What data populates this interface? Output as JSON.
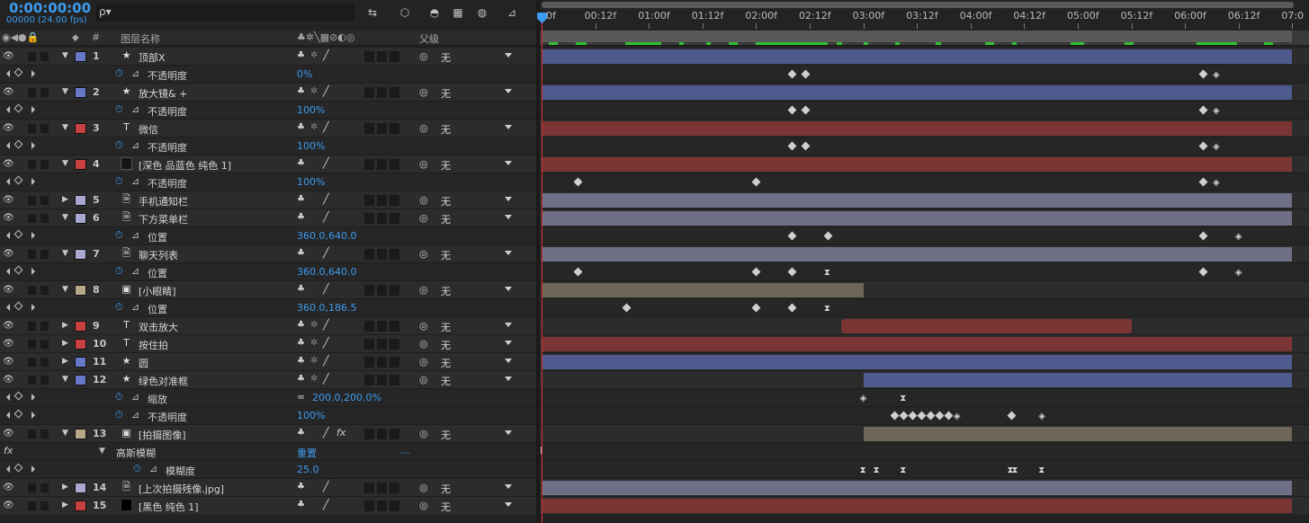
{
  "header": {
    "timecode": "0:00:00:00",
    "frames": "00000 (24.00 fps)",
    "search_icon": "ρ▾"
  },
  "columns": {
    "name": "图层名称",
    "number": "#",
    "parent": "父级"
  },
  "ruler": {
    "ticks": [
      "0f",
      "00:12f",
      "01:00f",
      "01:12f",
      "02:00f",
      "02:12f",
      "03:00f",
      "03:12f",
      "04:00f",
      "04:12f",
      "05:00f",
      "05:12f",
      "06:00f",
      "06:12f",
      "07:0"
    ]
  },
  "rows": [
    {
      "kind": "layer",
      "num": "1",
      "type": "star",
      "name": "顶部X",
      "color": "#6878c8",
      "twirl": "open",
      "switches": "shape",
      "parent": "无",
      "bar": {
        "start": 0,
        "end": 7.0,
        "color": "#4f5a8f"
      }
    },
    {
      "kind": "prop",
      "name": "不透明度",
      "value": "0%",
      "kf": [
        {
          "t": 2.333,
          "s": "d"
        },
        {
          "t": 2.458,
          "s": "d"
        },
        {
          "t": 6.167,
          "s": "d"
        },
        {
          "t": 6.292,
          "s": "h"
        }
      ]
    },
    {
      "kind": "layer",
      "num": "2",
      "type": "star",
      "name": "放大镜& +",
      "color": "#6878c8",
      "twirl": "open",
      "switches": "shape",
      "parent": "无",
      "bar": {
        "start": 0,
        "end": 7.0,
        "color": "#4f5a8f"
      }
    },
    {
      "kind": "prop",
      "name": "不透明度",
      "value": "100%",
      "kf": [
        {
          "t": 2.333,
          "s": "d"
        },
        {
          "t": 2.458,
          "s": "d"
        },
        {
          "t": 6.167,
          "s": "d"
        },
        {
          "t": 6.292,
          "s": "h"
        }
      ]
    },
    {
      "kind": "layer",
      "num": "3",
      "type": "text",
      "name": "微信",
      "color": "#c84040",
      "twirl": "open",
      "switches": "shape",
      "parent": "无",
      "bar": {
        "start": 0,
        "end": 7.0,
        "color": "#7c3535"
      }
    },
    {
      "kind": "prop",
      "name": "不透明度",
      "value": "100%",
      "kf": [
        {
          "t": 2.333,
          "s": "d"
        },
        {
          "t": 2.458,
          "s": "d"
        },
        {
          "t": 6.167,
          "s": "d"
        },
        {
          "t": 6.292,
          "s": "h"
        }
      ]
    },
    {
      "kind": "layer",
      "num": "4",
      "type": "solid",
      "name": "[深色 品蓝色 纯色 1]",
      "color": "#c84040",
      "twirl": "open",
      "switches": "plain",
      "parent": "无",
      "bar": {
        "start": 0,
        "end": 7.0,
        "color": "#7c3535"
      }
    },
    {
      "kind": "prop",
      "name": "不透明度",
      "value": "100%",
      "kf": [
        {
          "t": 0.333,
          "s": "d"
        },
        {
          "t": 2.0,
          "s": "d"
        },
        {
          "t": 6.167,
          "s": "d"
        },
        {
          "t": 6.292,
          "s": "h"
        }
      ]
    },
    {
      "kind": "layer",
      "num": "5",
      "type": "file",
      "name": "手机通知栏",
      "color": "#a8a8d0",
      "twirl": "closed",
      "switches": "plain",
      "parent": "无",
      "bar": {
        "start": 0,
        "end": 7.0,
        "color": "#6f6f86"
      }
    },
    {
      "kind": "layer",
      "num": "6",
      "type": "file",
      "name": "下方菜单栏",
      "color": "#a8a8d0",
      "twirl": "open",
      "switches": "plain",
      "parent": "无",
      "bar": {
        "start": 0,
        "end": 7.0,
        "color": "#6f6f86"
      }
    },
    {
      "kind": "prop",
      "name": "位置",
      "value": "360.0,640.0",
      "kf": [
        {
          "t": 2.333,
          "s": "d"
        },
        {
          "t": 2.667,
          "s": "d"
        },
        {
          "t": 6.167,
          "s": "d"
        },
        {
          "t": 6.5,
          "s": "h"
        }
      ]
    },
    {
      "kind": "layer",
      "num": "7",
      "type": "file",
      "name": "聊天列表",
      "color": "#a8a8d0",
      "twirl": "open",
      "switches": "plain",
      "parent": "无",
      "bar": {
        "start": 0,
        "end": 7.0,
        "color": "#6f6f86"
      }
    },
    {
      "kind": "prop",
      "name": "位置",
      "value": "360.0,640.0",
      "kf": [
        {
          "t": 0.333,
          "s": "d"
        },
        {
          "t": 2.0,
          "s": "d"
        },
        {
          "t": 2.333,
          "s": "d"
        },
        {
          "t": 2.667,
          "s": "x"
        },
        {
          "t": 6.167,
          "s": "d"
        },
        {
          "t": 6.5,
          "s": "h"
        }
      ]
    },
    {
      "kind": "layer",
      "num": "8",
      "type": "comp",
      "name": "[小眼睛]",
      "color": "#b8a888",
      "twirl": "open",
      "switches": "plain",
      "parent": "无",
      "bar": {
        "start": 0,
        "end": 3.0,
        "color": "#6e6656"
      }
    },
    {
      "kind": "prop",
      "name": "位置",
      "value": "360.0,186.5",
      "kf": [
        {
          "t": 0.792,
          "s": "d"
        },
        {
          "t": 2.0,
          "s": "d"
        },
        {
          "t": 2.333,
          "s": "d"
        },
        {
          "t": 2.667,
          "s": "x"
        }
      ]
    },
    {
      "kind": "layer",
      "num": "9",
      "type": "text",
      "name": "双击放大",
      "color": "#c84040",
      "twirl": "closed",
      "switches": "shape",
      "parent": "无",
      "bar": {
        "start": 2.792,
        "end": 5.5,
        "color": "#7c3535"
      }
    },
    {
      "kind": "layer",
      "num": "10",
      "type": "text",
      "name": "按住拍",
      "color": "#c84040",
      "twirl": "closed",
      "switches": "shape",
      "parent": "无",
      "bar": {
        "start": 0,
        "end": 7.0,
        "color": "#7c3535"
      }
    },
    {
      "kind": "layer",
      "num": "11",
      "type": "star",
      "name": "圆",
      "color": "#6878c8",
      "twirl": "closed",
      "switches": "shape",
      "parent": "无",
      "bar": {
        "start": 0,
        "end": 7.0,
        "color": "#4f5a8f"
      }
    },
    {
      "kind": "layer",
      "num": "12",
      "type": "star",
      "name": "绿色对准框",
      "color": "#6878c8",
      "twirl": "open",
      "switches": "shape",
      "parent": "无",
      "bar": {
        "start": 3.0,
        "end": 7.0,
        "color": "#4f5a8f"
      }
    },
    {
      "kind": "prop",
      "name": "缩放",
      "value": "200.0,200.0%",
      "link": true,
      "kf": [
        {
          "t": 3.0,
          "s": "h"
        },
        {
          "t": 3.375,
          "s": "x"
        }
      ]
    },
    {
      "kind": "prop",
      "name": "不透明度",
      "value": "100%",
      "kf": [
        {
          "t": 3.292,
          "s": "d"
        },
        {
          "t": 3.375,
          "s": "d"
        },
        {
          "t": 3.458,
          "s": "d"
        },
        {
          "t": 3.542,
          "s": "d"
        },
        {
          "t": 3.625,
          "s": "d"
        },
        {
          "t": 3.708,
          "s": "d"
        },
        {
          "t": 3.792,
          "s": "d"
        },
        {
          "t": 3.875,
          "s": "h"
        },
        {
          "t": 4.375,
          "s": "d"
        },
        {
          "t": 4.667,
          "s": "h"
        }
      ]
    },
    {
      "kind": "layer",
      "num": "13",
      "type": "comp",
      "name": "[拍摄图像]",
      "color": "#b8a888",
      "twirl": "open",
      "switches": "fx",
      "parent": "无",
      "bar": {
        "start": 3.0,
        "end": 7.0,
        "color": "#6e6656"
      }
    },
    {
      "kind": "effect",
      "fx": "fx",
      "name": "高斯模糊",
      "reset": "重置",
      "dots": "..."
    },
    {
      "kind": "prop",
      "name": "模糊度",
      "value": "25.0",
      "indent": true,
      "kf": [
        {
          "t": 3.0,
          "s": "x"
        },
        {
          "t": 3.125,
          "s": "x"
        },
        {
          "t": 3.375,
          "s": "x"
        },
        {
          "t": 4.375,
          "s": "x"
        },
        {
          "t": 4.417,
          "s": "x"
        },
        {
          "t": 4.667,
          "s": "x"
        }
      ]
    },
    {
      "kind": "layer",
      "num": "14",
      "type": "file",
      "name": "[上次拍摄残像.jpg]",
      "color": "#a8a8d0",
      "twirl": "closed",
      "switches": "plain",
      "parent": "无",
      "bar": {
        "start": 0,
        "end": 7.0,
        "color": "#6f6f86"
      }
    },
    {
      "kind": "layer",
      "num": "15",
      "type": "blk",
      "name": "[黑色 纯色 1]",
      "color": "#c84040",
      "twirl": "closed",
      "switches": "plain",
      "parent": "无",
      "bar": {
        "start": 0,
        "end": 7.0,
        "color": "#7c3535"
      }
    }
  ]
}
